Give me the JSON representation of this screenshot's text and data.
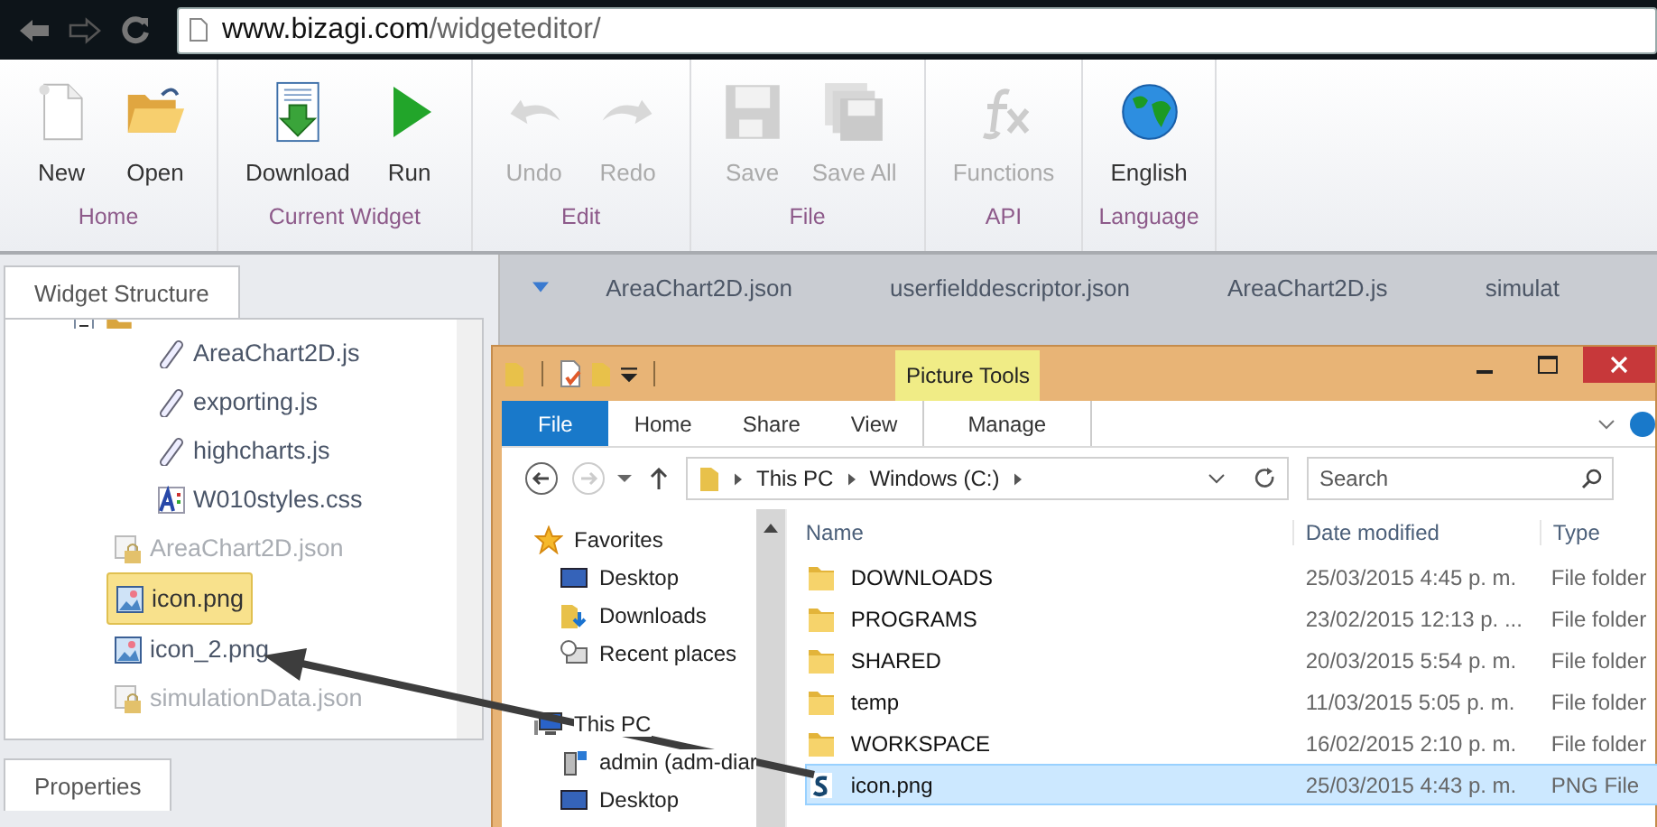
{
  "browser": {
    "url_host": "www.bizagi.com",
    "url_path": "/widgeteditor/"
  },
  "ribbon": {
    "groups": [
      {
        "label": "Home",
        "buttons": [
          {
            "kind": "new",
            "label": "New",
            "disabled": false
          },
          {
            "kind": "open",
            "label": "Open",
            "disabled": false
          }
        ]
      },
      {
        "label": "Current Widget",
        "buttons": [
          {
            "kind": "download",
            "label": "Download",
            "disabled": false
          },
          {
            "kind": "run",
            "label": "Run",
            "disabled": false
          }
        ]
      },
      {
        "label": "Edit",
        "buttons": [
          {
            "kind": "undo",
            "label": "Undo",
            "disabled": true
          },
          {
            "kind": "redo",
            "label": "Redo",
            "disabled": true
          }
        ]
      },
      {
        "label": "File",
        "buttons": [
          {
            "kind": "save",
            "label": "Save",
            "disabled": true
          },
          {
            "kind": "saveall",
            "label": "Save All",
            "disabled": true
          }
        ]
      },
      {
        "label": "API",
        "buttons": [
          {
            "kind": "functions",
            "label": "Functions",
            "disabled": true
          }
        ]
      },
      {
        "label": "Language",
        "buttons": [
          {
            "kind": "globe",
            "label": "English",
            "disabled": false
          }
        ]
      }
    ]
  },
  "widget_structure": {
    "title": "Widget Structure",
    "tree": [
      {
        "kind": "folder",
        "expanded": true,
        "children": [
          {
            "kind": "js",
            "label": "AreaChart2D.js",
            "locked": false,
            "selected": false
          },
          {
            "kind": "js",
            "label": "exporting.js",
            "locked": false,
            "selected": false
          },
          {
            "kind": "js",
            "label": "highcharts.js",
            "locked": false,
            "selected": false
          },
          {
            "kind": "css",
            "label": "W010styles.css",
            "locked": false,
            "selected": false
          }
        ]
      },
      {
        "kind": "json",
        "label": "AreaChart2D.json",
        "locked": true,
        "selected": false
      },
      {
        "kind": "image",
        "label": "icon.png",
        "locked": false,
        "selected": true
      },
      {
        "kind": "image",
        "label": "icon_2.png",
        "locked": false,
        "selected": false
      },
      {
        "kind": "json",
        "label": "simulationData.json",
        "locked": true,
        "selected": false
      }
    ]
  },
  "properties": {
    "title": "Properties"
  },
  "editor_tabs": [
    "AreaChart2D.json",
    "userfielddescriptor.json",
    "AreaChart2D.js",
    "simulat"
  ],
  "explorer": {
    "contextual_tab": "Picture Tools",
    "tabs": [
      {
        "label": "File",
        "selected": true
      },
      {
        "label": "Home",
        "selected": false
      },
      {
        "label": "Share",
        "selected": false
      },
      {
        "label": "View",
        "selected": false
      },
      {
        "label": "Manage",
        "selected": false
      }
    ],
    "path": [
      "This PC",
      "Windows (C:)"
    ],
    "search_placeholder": "Search",
    "nav": [
      {
        "kind": "favorites",
        "label": "Favorites",
        "children": [
          {
            "kind": "desktop",
            "label": "Desktop"
          },
          {
            "kind": "downloads",
            "label": "Downloads"
          },
          {
            "kind": "recent",
            "label": "Recent places"
          }
        ]
      },
      {
        "kind": "pc",
        "label": "This PC",
        "children": [
          {
            "kind": "network",
            "label": "admin (adm-diar"
          },
          {
            "kind": "desktop",
            "label": "Desktop"
          }
        ]
      }
    ],
    "columns": [
      "Name",
      "Date modified",
      "Type"
    ],
    "files": [
      {
        "kind": "folder",
        "name": "DOWNLOADS",
        "date": "25/03/2015 4:45 p. m.",
        "type": "File folder",
        "selected": false
      },
      {
        "kind": "folder",
        "name": "PROGRAMS",
        "date": "23/02/2015 12:13 p. ...",
        "type": "File folder",
        "selected": false
      },
      {
        "kind": "folder",
        "name": "SHARED",
        "date": "20/03/2015 5:54 p. m.",
        "type": "File folder",
        "selected": false
      },
      {
        "kind": "folder",
        "name": "temp",
        "date": "11/03/2015 5:05 p. m.",
        "type": "File folder",
        "selected": false
      },
      {
        "kind": "folder",
        "name": "WORKSPACE",
        "date": "16/02/2015 2:10 p. m.",
        "type": "File folder",
        "selected": false
      },
      {
        "kind": "png",
        "name": "icon.png",
        "date": "25/03/2015 4:43 p. m.",
        "type": "PNG File",
        "selected": true
      }
    ]
  }
}
